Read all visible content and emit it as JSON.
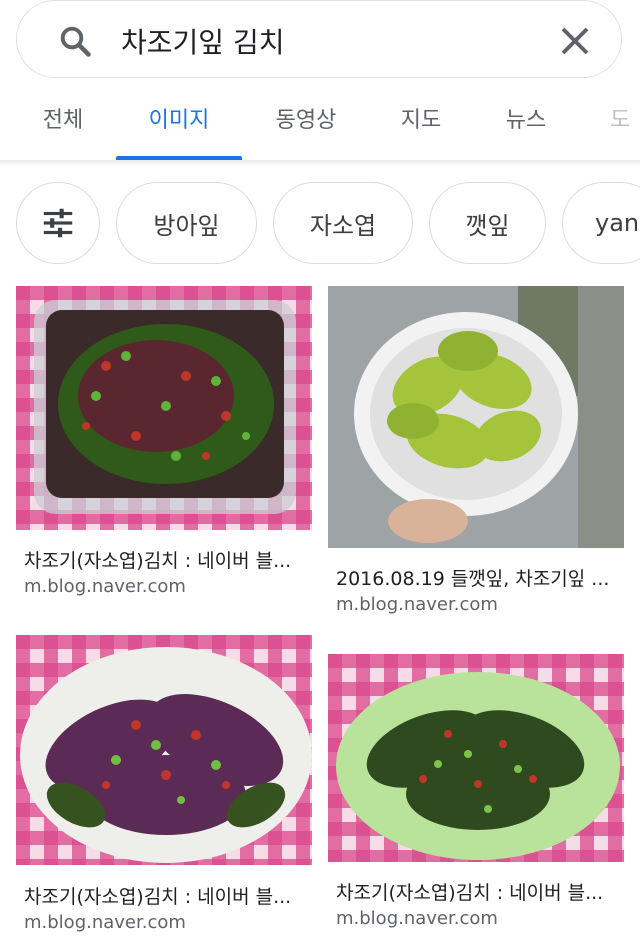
{
  "search": {
    "query": "차조기잎 김치",
    "search_icon": "search-icon",
    "clear_icon": "close-icon"
  },
  "tabs": [
    {
      "label": "전체",
      "active": false
    },
    {
      "label": "이미지",
      "active": true
    },
    {
      "label": "동영상",
      "active": false
    },
    {
      "label": "지도",
      "active": false
    },
    {
      "label": "뉴스",
      "active": false
    },
    {
      "label": "도",
      "active": false
    }
  ],
  "chips": {
    "filter_icon": "tune-icon",
    "items": [
      "방아잎",
      "자소엽",
      "깻잎",
      "yan"
    ]
  },
  "results": [
    {
      "title": "차조기(자소엽)김치 : 네이버 블...",
      "source": "m.blog.naver.com"
    },
    {
      "title": "2016.08.19 들깻잎, 차조기잎 ...",
      "source": "m.blog.naver.com"
    },
    {
      "title": "차조기(자소엽)김치 : 네이버 블...",
      "source": "m.blog.naver.com"
    },
    {
      "title": "차조기(자소엽)김치 : 네이버 블...",
      "source": "m.blog.naver.com"
    }
  ]
}
